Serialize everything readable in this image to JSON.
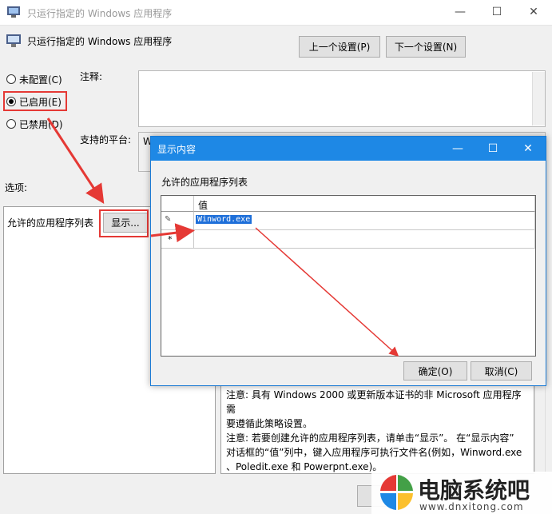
{
  "window": {
    "title": "只运行指定的 Windows 应用程序",
    "minimize": "—",
    "maximize": "☐",
    "close": "✕"
  },
  "header": {
    "title": "只运行指定的 Windows 应用程序",
    "prev_button": "上一个设置(P)",
    "next_button": "下一个设置(N)"
  },
  "radios": [
    {
      "label": "未配置(C)",
      "checked": false
    },
    {
      "label": "已启用(E)",
      "checked": true
    },
    {
      "label": "已禁用(D)",
      "checked": false
    }
  ],
  "labels": {
    "comment": "注释:",
    "supported": "支持的平台:",
    "supported_value": "W",
    "options": "选项:",
    "allowed_list": "允许的应用程序列表",
    "show_button": "显示..."
  },
  "help": {
    "line1": "注意: 具有 Windows 2000 或更新版本证书的非 Microsoft 应用程序需",
    "line2": "要遵循此策略设置。",
    "line3": "注意: 若要创建允许的应用程序列表，请单击“显示”。 在“显示内容”",
    "line4": "对话框的“值”列中，键入应用程序可执行文件名(例如，Winword.exe",
    "line5": "、Poledit.exe 和 Powerpnt.exe)。"
  },
  "dialog": {
    "title": "显示内容",
    "minimize": "—",
    "maximize": "☐",
    "close": "✕",
    "list_label": "允许的应用程序列表",
    "column_header": "值",
    "rows": [
      {
        "marker": "✎",
        "value": "Winword.exe"
      },
      {
        "marker": "*",
        "value": ""
      }
    ],
    "ok_button": "确定(O)",
    "cancel_button": "取消(C)"
  },
  "watermark": {
    "title": "电脑系统吧",
    "url": "www.dnxitong.com"
  },
  "colors": {
    "accent": "#1e88e5",
    "annotation": "#e53935",
    "selection": "#1e6fd9"
  }
}
